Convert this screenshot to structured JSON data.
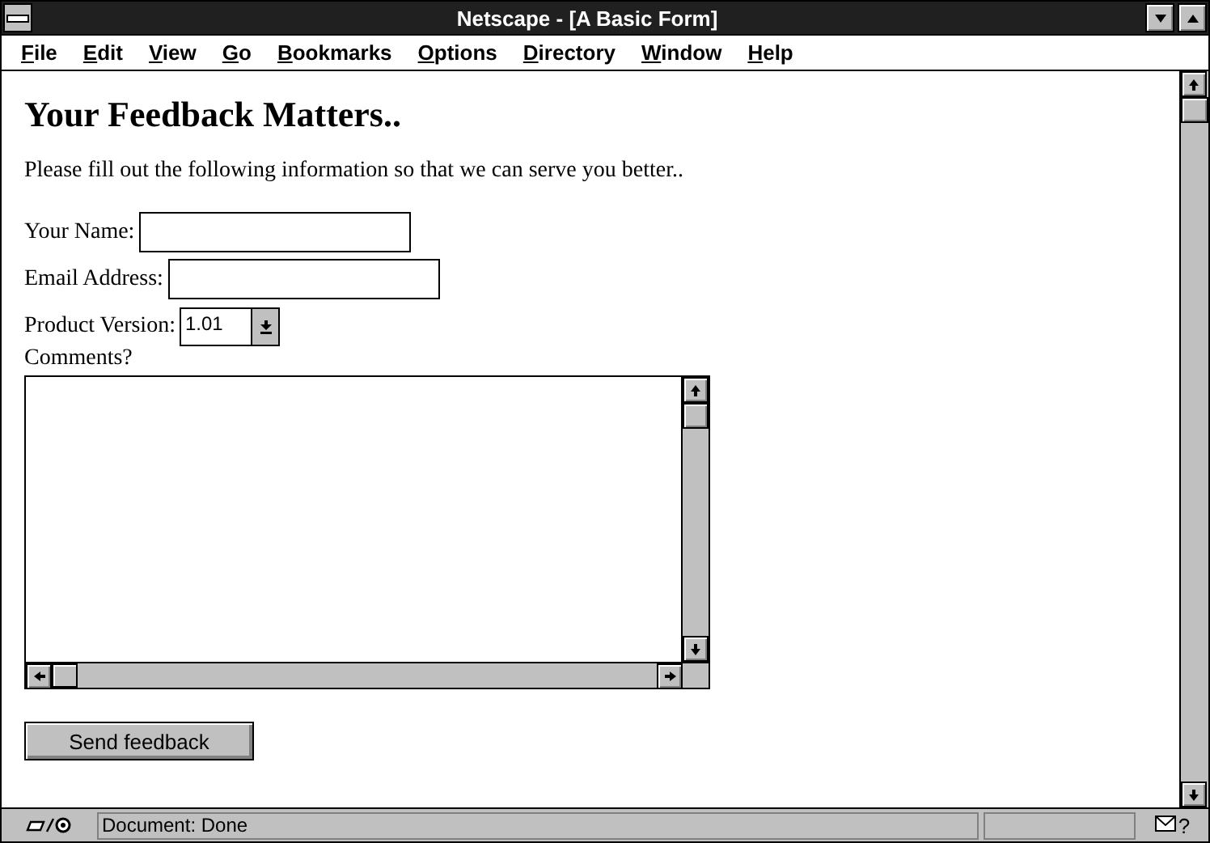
{
  "window": {
    "title": "Netscape - [A Basic Form]"
  },
  "menu": [
    "File",
    "Edit",
    "View",
    "Go",
    "Bookmarks",
    "Options",
    "Directory",
    "Window",
    "Help"
  ],
  "page": {
    "heading": "Your Feedback Matters..",
    "intro": "Please fill out the following information so that we can serve you better..",
    "fields": [
      {
        "label": "Your Name:",
        "kind": "text"
      },
      {
        "label": "Email Address:",
        "kind": "text"
      },
      {
        "label": "Product Version:",
        "kind": "select",
        "value": "1.01"
      }
    ],
    "comments_label": "Comments?",
    "submit": "Send feedback"
  },
  "status_bar": {
    "text": "Document:  Done",
    "help": "?"
  }
}
